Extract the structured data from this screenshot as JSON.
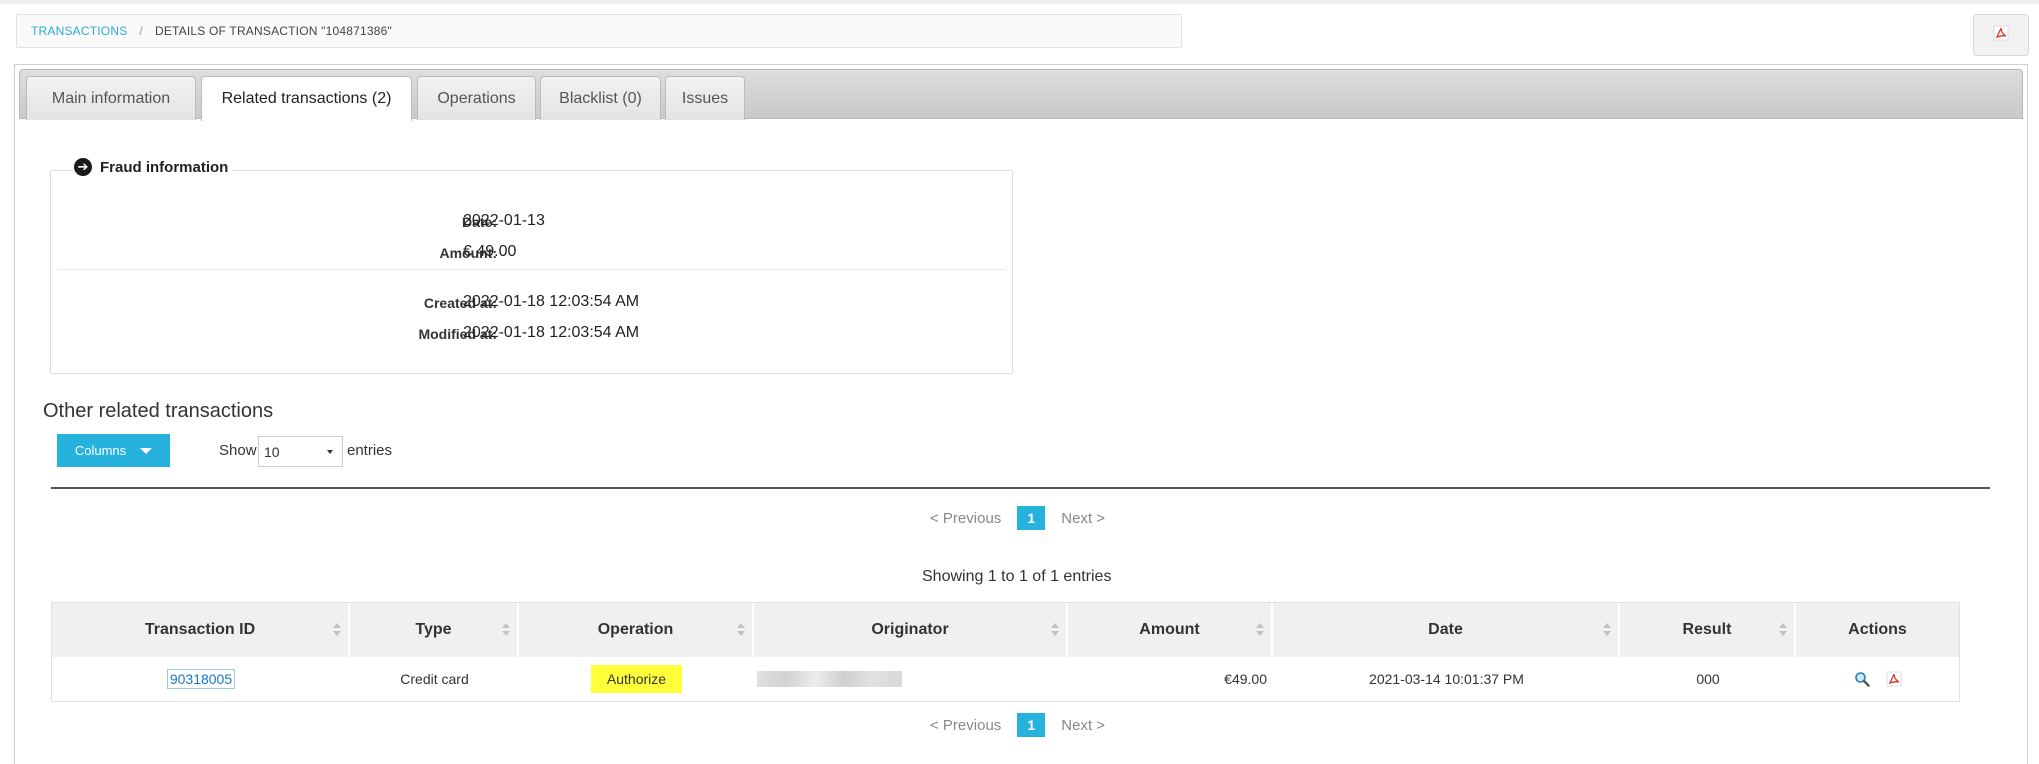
{
  "breadcrumb": {
    "root": "TRANSACTIONS",
    "separator": "/",
    "current": "DETAILS OF TRANSACTION \"104871386\""
  },
  "tabs": [
    {
      "label": "Main information",
      "active": false
    },
    {
      "label": "Related transactions (2)",
      "active": true
    },
    {
      "label": "Operations",
      "active": false
    },
    {
      "label": "Blacklist (0)",
      "active": false
    },
    {
      "label": "Issues",
      "active": false
    }
  ],
  "fraud": {
    "legend": "Fraud information",
    "date_label": "Date:",
    "date_value": "2022-01-13",
    "amount_label": "Amount:",
    "amount_value": "€ 49.00",
    "created_label": "Created at:",
    "created_value": "2022-01-18 12:03:54 AM",
    "modified_label": "Modified at:",
    "modified_value": "2022-01-18 12:03:54 AM"
  },
  "related": {
    "title": "Other related transactions",
    "columns_button": "Columns",
    "show_label": "Show",
    "page_size": "10",
    "entries_label": "entries",
    "pager": {
      "prev": "< Previous",
      "page": "1",
      "next": "Next >"
    },
    "showing": "Showing 1 to 1 of 1 entries",
    "headers": [
      "Transaction ID",
      "Type",
      "Operation",
      "Originator",
      "Amount",
      "Date",
      "Result",
      "Actions"
    ],
    "rows": [
      {
        "transaction_id": "90318005",
        "type": "Credit card",
        "operation": "Authorize",
        "originator": "",
        "amount": "€49.00",
        "date": "2021-03-14 10:01:37 PM",
        "result": "000"
      }
    ]
  },
  "colors": {
    "accent": "#27b1dd",
    "link": "#29abd6",
    "highlight": "#ffff3a",
    "pdf_red": "#e0302b"
  },
  "icons": {
    "pdf": "pdf-icon",
    "search": "magnifier-icon",
    "legend": "arrow-circle-right-icon"
  }
}
